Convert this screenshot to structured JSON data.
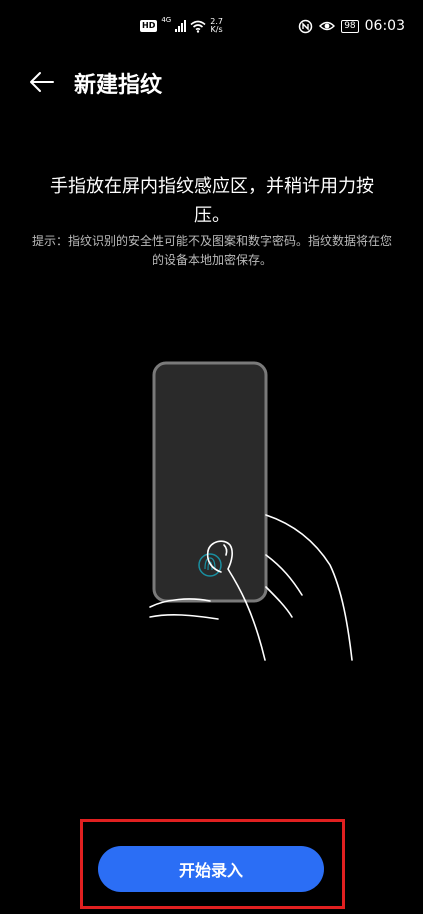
{
  "status_bar": {
    "hd": "HD",
    "network": "4G",
    "speed_value": "2.7",
    "speed_unit": "K/s",
    "battery": "98",
    "time": "06:03"
  },
  "header": {
    "title": "新建指纹"
  },
  "main": {
    "instruction": "手指放在屏内指纹感应区，并稍许用力按压。",
    "hint": "提示：指纹识别的安全性可能不及图案和数字密码。指纹数据将在您的设备本地加密保存。"
  },
  "footer": {
    "start_button_label": "开始录入"
  }
}
